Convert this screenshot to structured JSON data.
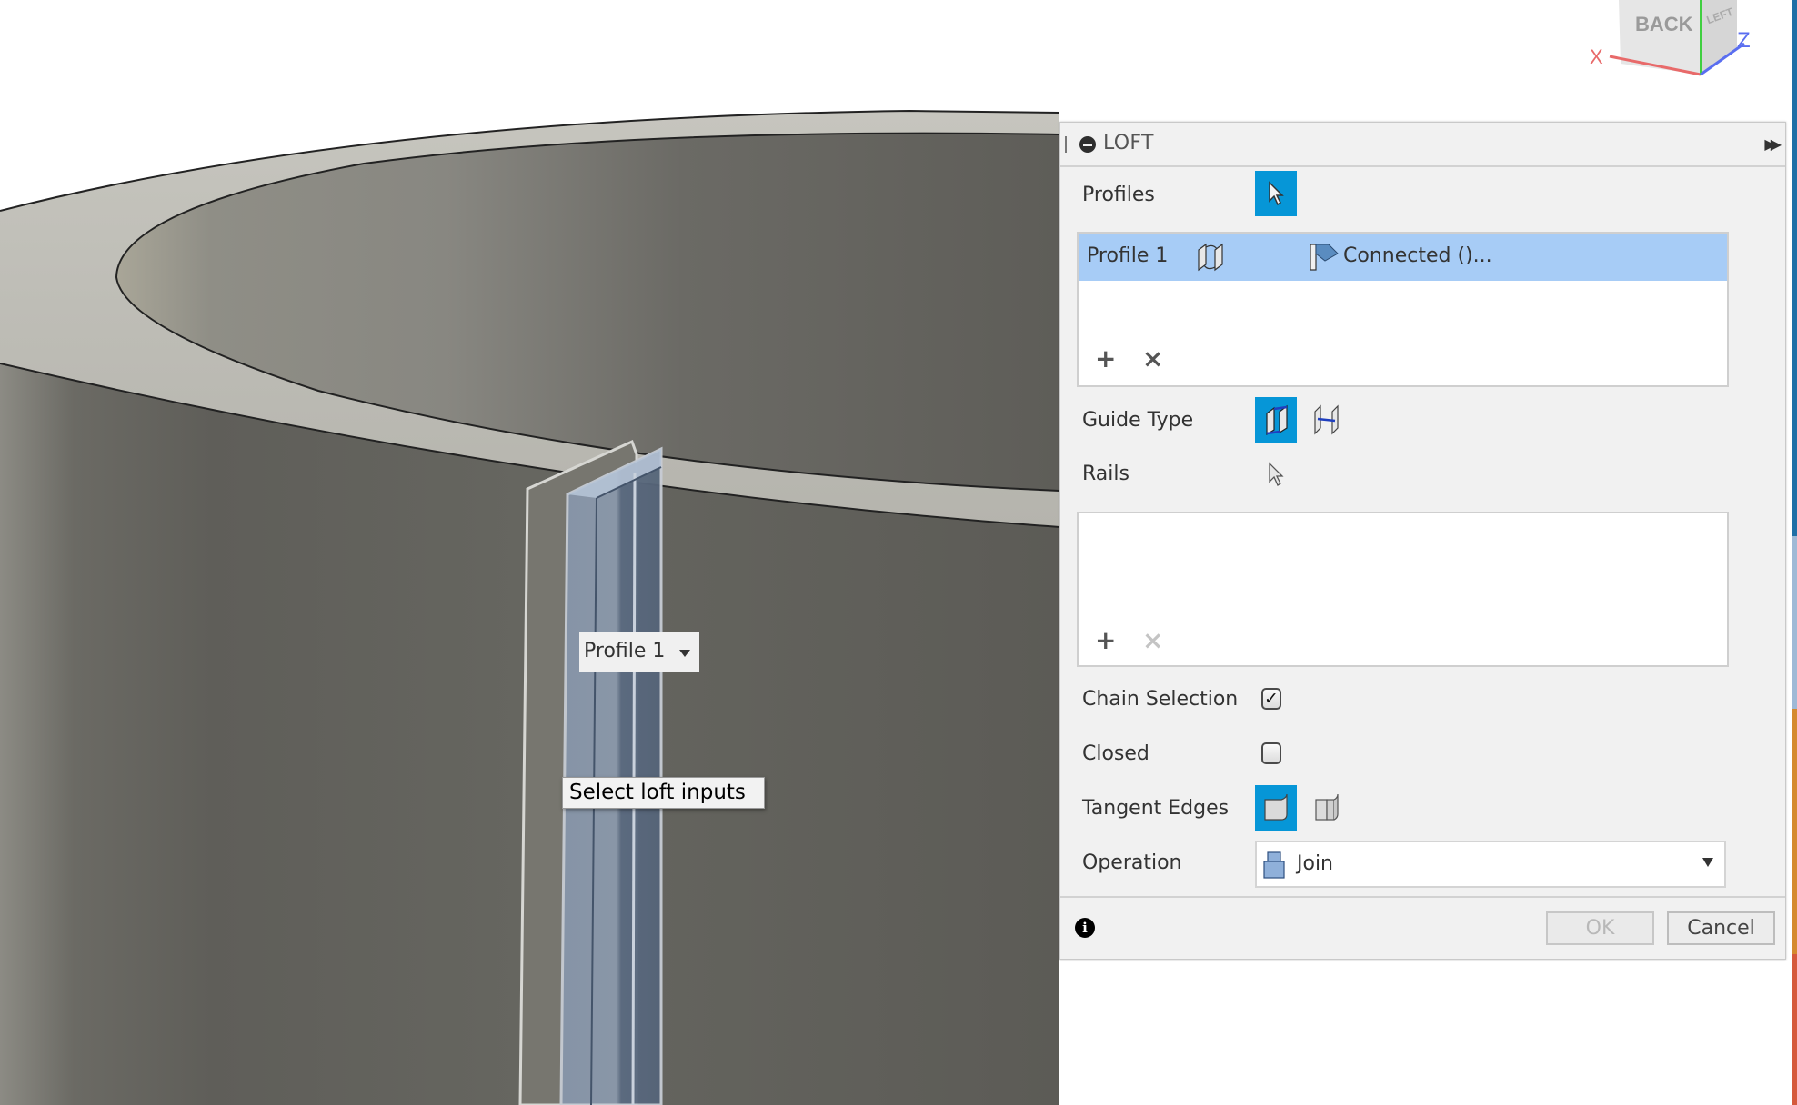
{
  "viewport": {
    "view_cube": {
      "front_face_label": "BACK",
      "side_face_label": "LEFT",
      "axis_x_label": "X",
      "axis_z_label": "Z",
      "axis_x_color": "#e86a6a",
      "axis_y_color": "#3fcf3f",
      "axis_z_color": "#5a6ef0"
    },
    "profile_tag": {
      "label": "Profile 1"
    },
    "tooltip": "Select loft inputs",
    "body_color": "#6a6a64",
    "rim_color": "#bdbcb5",
    "loft_preview_color": "#8a9bb0"
  },
  "side_strip": {
    "colors": [
      "#1f6fa6",
      "#9fb9d6",
      "#d58a2e",
      "#d55a3c"
    ]
  },
  "loft_panel": {
    "title": "LOFT",
    "expand_icon": "double-chevron-right",
    "collapse_icon": "minus-circle",
    "profiles": {
      "label": "Profiles",
      "select_icon": "cursor-arrow-icon",
      "selected": true,
      "items": [
        {
          "name": "Profile 1",
          "direction_icon": "flip-direction-icon",
          "condition_icon": "connected-flag-icon",
          "condition": "Connected ()..."
        }
      ],
      "add_label": "+",
      "remove_label": "×",
      "remove_enabled": true
    },
    "guide_type": {
      "label": "Guide Type",
      "options": [
        {
          "name": "rails",
          "icon": "guide-rails-icon",
          "active": true
        },
        {
          "name": "centerline",
          "icon": "guide-centerline-icon",
          "active": false
        }
      ]
    },
    "rails": {
      "label": "Rails",
      "select_icon": "cursor-arrow-icon",
      "items": [],
      "add_label": "+",
      "remove_label": "×",
      "remove_enabled": false
    },
    "chain_selection": {
      "label": "Chain Selection",
      "checked": true,
      "check_glyph": "✓"
    },
    "closed": {
      "label": "Closed",
      "checked": false
    },
    "tangent_edges": {
      "label": "Tangent Edges",
      "options": [
        {
          "name": "merge",
          "icon": "tangent-merge-icon",
          "active": true
        },
        {
          "name": "keep",
          "icon": "tangent-keep-icon",
          "active": false
        }
      ]
    },
    "operation": {
      "label": "Operation",
      "value": "Join",
      "icon": "join-icon"
    },
    "footer": {
      "info_glyph": "i",
      "ok_label": "OK",
      "ok_enabled": false,
      "cancel_label": "Cancel"
    },
    "accent_color": "#0696d7",
    "selection_color": "#a7ccf6"
  }
}
